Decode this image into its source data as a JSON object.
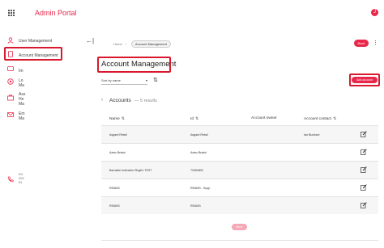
{
  "header": {
    "title": "Admin Portal",
    "avatar_letter": "J"
  },
  "sidebar": {
    "items": [
      {
        "label": "User Management"
      },
      {
        "label": "Account Management"
      },
      {
        "label": "Im"
      },
      {
        "label": "Lo\nMa"
      },
      {
        "label": "Ass\nHe\nMa"
      },
      {
        "label": "Em\nMa"
      }
    ],
    "footer_text": "EV\n202\nEL"
  },
  "breadcrumb": {
    "home": "Home",
    "current": "Account Management"
  },
  "toolbar": {
    "back_label": "Back"
  },
  "page": {
    "title": "Account Management",
    "sort_select": "Sort by name",
    "add_button": "Add account"
  },
  "section": {
    "title": "Accounts",
    "count": "5 results"
  },
  "table": {
    "headers": [
      "Name",
      "Id",
      "Account owner",
      "Account contact"
    ],
    "rows": [
      {
        "name": "Asgard Retail",
        "id": "Asgard Retail",
        "owner": "",
        "contact": "Ian Buchard"
      },
      {
        "name": "Aztec Bristol",
        "id": "Aztec Bristol",
        "owner": "",
        "contact": ""
      },
      {
        "name": "Barnside Indication RegEx TEST",
        "id": "72364892",
        "owner": "",
        "contact": ""
      },
      {
        "name": "REAMS",
        "id": "REAMS - Supp",
        "owner": "",
        "contact": ""
      },
      {
        "name": "REAMS",
        "id": "REAMS",
        "owner": "",
        "contact": ""
      }
    ]
  },
  "pager": {
    "more_label": "More"
  },
  "colors": {
    "accent": "#e8274b",
    "highlight": "#d9182e"
  }
}
